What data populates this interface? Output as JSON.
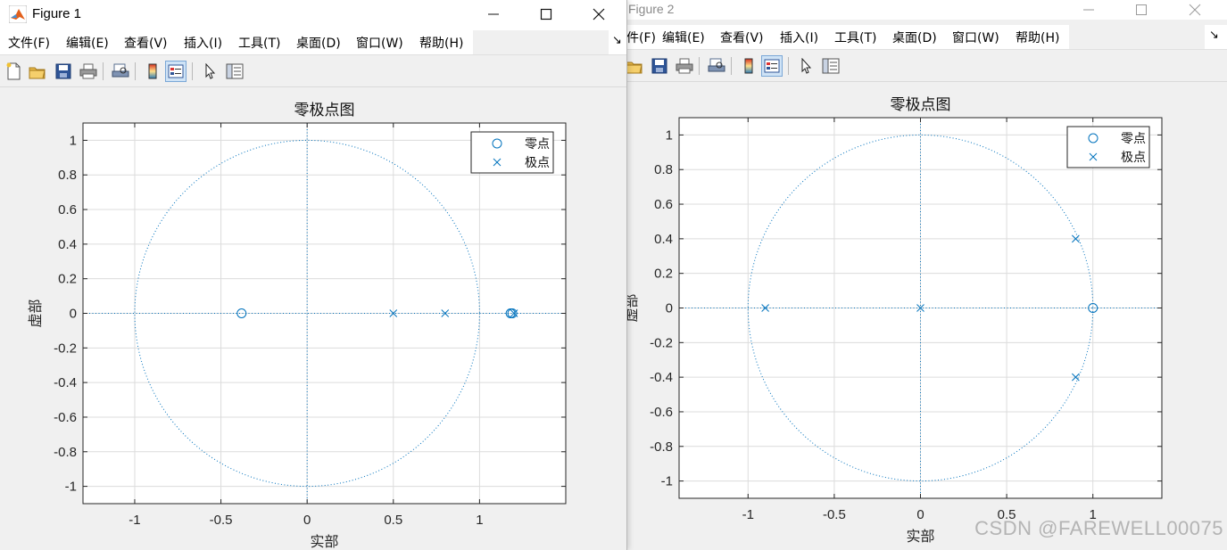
{
  "colors": {
    "accent": "#0072bd",
    "grid": "#dcdcdc",
    "axes": "#262626",
    "background": "#f0f0f0"
  },
  "figure1": {
    "title": "Figure 1",
    "menu": [
      "文件(F)",
      "编辑(E)",
      "查看(V)",
      "插入(I)",
      "工具(T)",
      "桌面(D)",
      "窗口(W)",
      "帮助(H)"
    ],
    "toolbar_icons": [
      "new-file-icon",
      "open-folder-icon",
      "save-icon",
      "print-icon",
      "print-preview-icon",
      "colorbar-icon",
      "legend-icon",
      "pointer-icon",
      "property-inspector-icon"
    ]
  },
  "figure2": {
    "title": "Figure 2",
    "menu": [
      "件(F)",
      "编辑(E)",
      "查看(V)",
      "插入(I)",
      "工具(T)",
      "桌面(D)",
      "窗口(W)",
      "帮助(H)"
    ],
    "toolbar_icons": [
      "open-folder-icon",
      "save-icon",
      "print-icon",
      "print-preview-icon",
      "colorbar-icon",
      "legend-icon",
      "pointer-icon",
      "property-inspector-icon"
    ]
  },
  "chart_data": [
    {
      "type": "scatter",
      "title": "零极点图",
      "xlabel": "实部",
      "ylabel": "虚部",
      "xlim": [
        -1.3,
        1.5
      ],
      "ylim": [
        -1.1,
        1.1
      ],
      "xticks": [
        -1,
        -0.5,
        0,
        0.5,
        1
      ],
      "yticks": [
        -1,
        -0.8,
        -0.6,
        -0.4,
        -0.2,
        0,
        0.2,
        0.4,
        0.6,
        0.8,
        1
      ],
      "grid": true,
      "unit_circle": true,
      "legend_position": "top-right",
      "series": [
        {
          "name": "零点",
          "marker": "circle",
          "x": [
            -0.38,
            1.18,
            1.19
          ],
          "y": [
            0,
            0,
            0
          ]
        },
        {
          "name": "极点",
          "marker": "cross",
          "x": [
            0.5,
            0.8,
            1.2
          ],
          "y": [
            0,
            0,
            0
          ]
        }
      ]
    },
    {
      "type": "scatter",
      "title": "零极点图",
      "xlabel": "实部",
      "ylabel": "虚部",
      "xlim": [
        -1.4,
        1.4
      ],
      "ylim": [
        -1.1,
        1.1
      ],
      "xticks": [
        -1,
        -0.5,
        0,
        0.5,
        1
      ],
      "yticks": [
        -1,
        -0.8,
        -0.6,
        -0.4,
        -0.2,
        0,
        0.2,
        0.4,
        0.6,
        0.8,
        1
      ],
      "grid": true,
      "unit_circle": true,
      "legend_position": "top-right",
      "series": [
        {
          "name": "零点",
          "marker": "circle",
          "x": [
            1
          ],
          "y": [
            0
          ]
        },
        {
          "name": "极点",
          "marker": "cross",
          "x": [
            -0.9,
            0,
            0.9,
            0.9
          ],
          "y": [
            0,
            0,
            0.4,
            -0.4
          ]
        }
      ]
    }
  ],
  "watermark": "CSDN @FAREWELL00075"
}
